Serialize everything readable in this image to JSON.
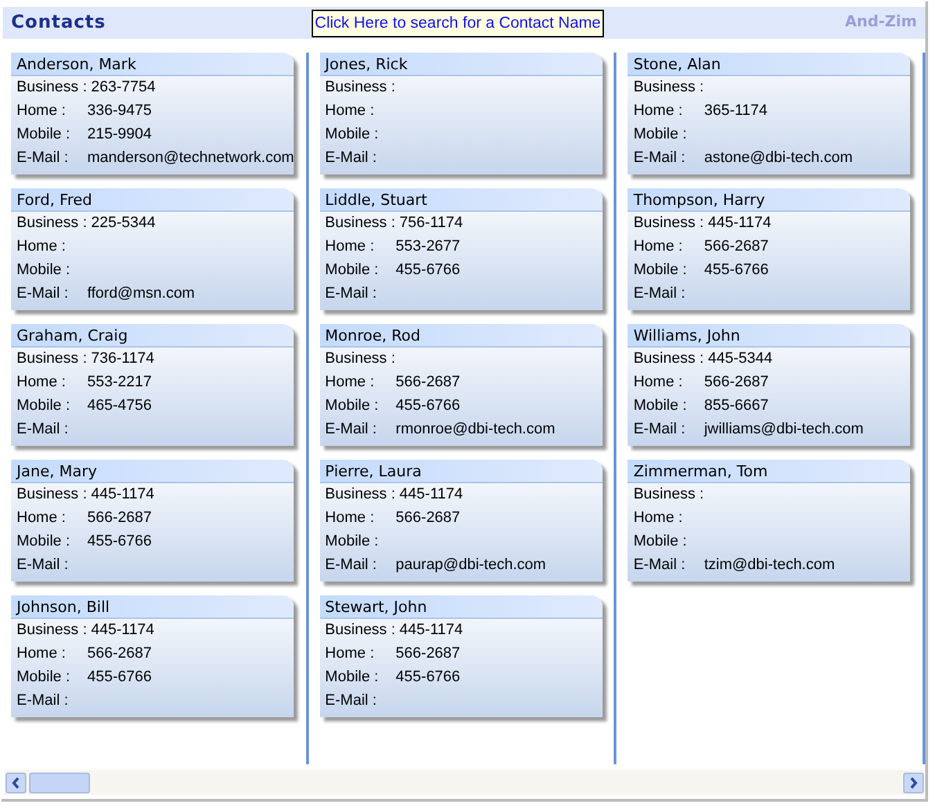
{
  "header": {
    "title": "Contacts",
    "search_button": "Click Here to search for a Contact Name",
    "range": "And-Zim"
  },
  "columns": [
    {
      "contacts": [
        {
          "name": "Anderson, Mark",
          "fields": [
            {
              "label": "Business :",
              "value": "263-7754"
            },
            {
              "label": "Home :",
              "value": "336-9475"
            },
            {
              "label": "Mobile :",
              "value": "215-9904"
            },
            {
              "label": "E-Mail :",
              "value": "manderson@technetwork.com"
            }
          ]
        },
        {
          "name": "Ford, Fred",
          "fields": [
            {
              "label": "Business :",
              "value": "225-5344"
            },
            {
              "label": "Home :"
            },
            {
              "label": "Mobile :"
            },
            {
              "label": "E-Mail :",
              "value": "fford@msn.com"
            }
          ]
        },
        {
          "name": "Graham, Craig",
          "fields": [
            {
              "label": "Business :",
              "value": "736-1174"
            },
            {
              "label": "Home :",
              "value": "553-2217"
            },
            {
              "label": "Mobile :",
              "value": "465-4756"
            },
            {
              "label": "E-Mail :"
            }
          ]
        },
        {
          "name": "Jane, Mary",
          "fields": [
            {
              "label": "Business :",
              "value": "445-1174"
            },
            {
              "label": "Home :",
              "value": "566-2687"
            },
            {
              "label": "Mobile :",
              "value": "455-6766"
            },
            {
              "label": "E-Mail :"
            }
          ]
        },
        {
          "name": "Johnson, Bill",
          "fields": [
            {
              "label": "Business :",
              "value": "445-1174"
            },
            {
              "label": "Home :",
              "value": "566-2687"
            },
            {
              "label": "Mobile :",
              "value": "455-6766"
            },
            {
              "label": "E-Mail :"
            }
          ]
        }
      ]
    },
    {
      "contacts": [
        {
          "name": "Jones, Rick",
          "fields": [
            {
              "label": "Business :"
            },
            {
              "label": "Home :"
            },
            {
              "label": "Mobile :"
            },
            {
              "label": "E-Mail :"
            }
          ]
        },
        {
          "name": "Liddle, Stuart",
          "fields": [
            {
              "label": "Business :",
              "value": "756-1174"
            },
            {
              "label": "Home :",
              "value": "553-2677"
            },
            {
              "label": "Mobile :",
              "value": "455-6766"
            },
            {
              "label": "E-Mail :"
            }
          ]
        },
        {
          "name": "Monroe, Rod",
          "fields": [
            {
              "label": "Business :"
            },
            {
              "label": "Home :",
              "value": "566-2687"
            },
            {
              "label": "Mobile :",
              "value": "455-6766"
            },
            {
              "label": "E-Mail :",
              "value": "rmonroe@dbi-tech.com"
            }
          ]
        },
        {
          "name": "Pierre, Laura",
          "fields": [
            {
              "label": "Business :",
              "value": "445-1174"
            },
            {
              "label": "Home :",
              "value": "566-2687"
            },
            {
              "label": "Mobile :"
            },
            {
              "label": "E-Mail :",
              "value": "paurap@dbi-tech.com"
            }
          ]
        },
        {
          "name": "Stewart, John",
          "fields": [
            {
              "label": "Business :",
              "value": "445-1174"
            },
            {
              "label": "Home :",
              "value": "566-2687"
            },
            {
              "label": "Mobile :",
              "value": "455-6766"
            },
            {
              "label": "E-Mail :"
            }
          ]
        }
      ]
    },
    {
      "contacts": [
        {
          "name": "Stone, Alan",
          "fields": [
            {
              "label": "Business :"
            },
            {
              "label": "Home :",
              "value": "365-1174"
            },
            {
              "label": "Mobile :"
            },
            {
              "label": "E-Mail :",
              "value": "astone@dbi-tech.com"
            }
          ]
        },
        {
          "name": "Thompson, Harry",
          "fields": [
            {
              "label": "Business :",
              "value": "445-1174"
            },
            {
              "label": "Home :",
              "value": "566-2687"
            },
            {
              "label": "Mobile :",
              "value": "455-6766"
            },
            {
              "label": "E-Mail :"
            }
          ]
        },
        {
          "name": "Williams, John",
          "fields": [
            {
              "label": "Business :",
              "value": "445-5344"
            },
            {
              "label": "Home :",
              "value": "566-2687"
            },
            {
              "label": "Mobile :",
              "value": "855-6667"
            },
            {
              "label": "E-Mail :",
              "value": "jwilliams@dbi-tech.com"
            }
          ]
        },
        {
          "name": "Zimmerman, Tom",
          "fields": [
            {
              "label": "Business :"
            },
            {
              "label": "Home :"
            },
            {
              "label": "Mobile :"
            },
            {
              "label": "E-Mail :",
              "value": "tzim@dbi-tech.com"
            }
          ]
        }
      ]
    }
  ]
}
